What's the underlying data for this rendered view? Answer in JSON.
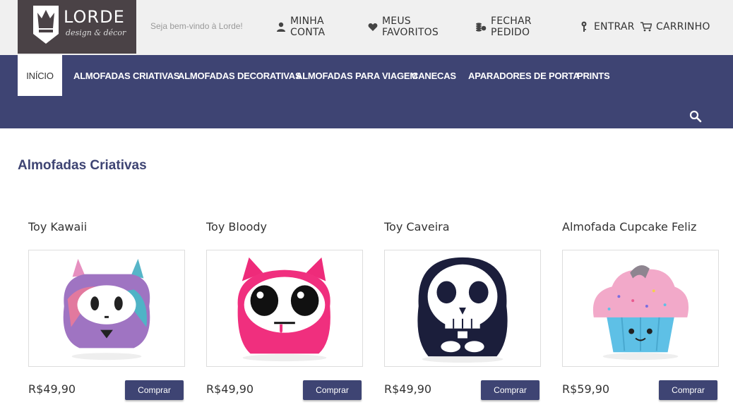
{
  "brand": {
    "name": "LORDE",
    "tagline": "design & décor"
  },
  "header": {
    "welcome": "Seja bem-vindo à Lorde!",
    "links": [
      {
        "label": "MINHA CONTA",
        "icon": "user-icon"
      },
      {
        "label": "MEUS FAVORITOS",
        "icon": "heart-icon"
      },
      {
        "label": "FECHAR PEDIDO",
        "icon": "coins-icon"
      },
      {
        "label": "ENTRAR",
        "icon": "key-icon"
      },
      {
        "label": "CARRINHO",
        "icon": "cart-icon"
      }
    ]
  },
  "nav": {
    "items": [
      {
        "label": "INÍCIO"
      },
      {
        "label": "ALMOFADAS CRIATIVAS"
      },
      {
        "label": "ALMOFADAS DECORATIVAS"
      },
      {
        "label": "ALMOFADAS PARA VIAGEM"
      },
      {
        "label": "CANECAS"
      },
      {
        "label": "APARADORES DE PORTA"
      },
      {
        "label": "PRINTS"
      }
    ]
  },
  "section": {
    "title": "Almofadas Criativas"
  },
  "products": [
    {
      "name": "Toy Kawaii",
      "price": "R$49,90",
      "buy_label": "Comprar"
    },
    {
      "name": "Toy Bloody",
      "price": "R$49,90",
      "buy_label": "Comprar"
    },
    {
      "name": "Toy Caveira",
      "price": "R$49,90",
      "buy_label": "Comprar"
    },
    {
      "name": "Almofada Cupcake Feliz",
      "price": "R$59,90",
      "buy_label": "Comprar"
    }
  ],
  "colors": {
    "accent": "#3e4473",
    "logo_bg": "#4a4246",
    "topbar_bg": "#f0f0f0"
  }
}
